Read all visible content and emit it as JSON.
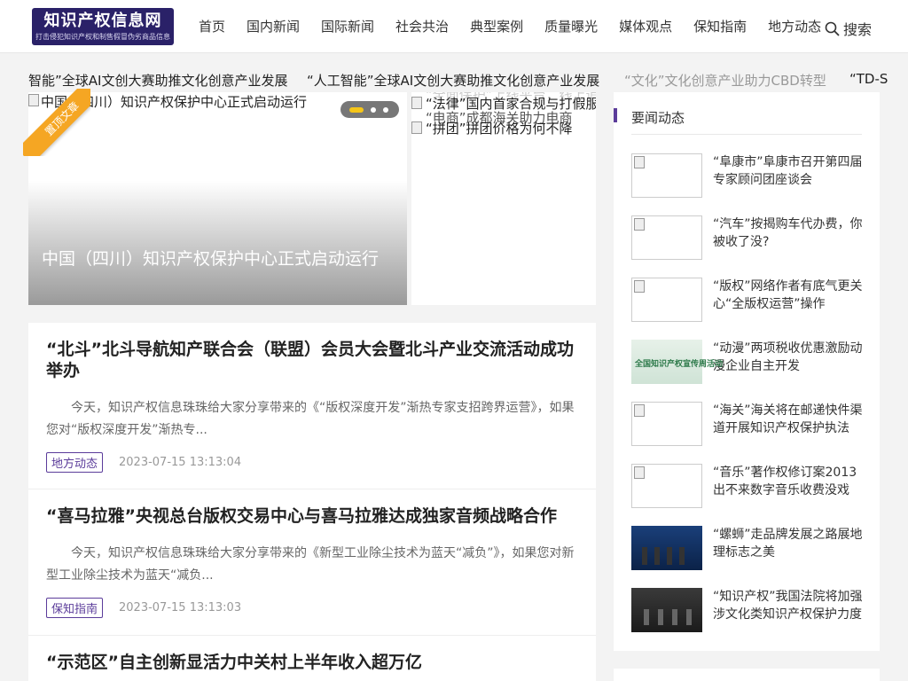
{
  "header": {
    "logo_title": "知识产权信息网",
    "logo_subtitle": "打击侵犯知识产权和制售假冒伪劣商品信息",
    "nav": [
      "首页",
      "国内新闻",
      "国际新闻",
      "社会共治",
      "典型案例",
      "质量曝光",
      "媒体观点",
      "保知指南",
      "地方动态"
    ],
    "search_label": "搜索",
    "search_icon": "magnifier-icon"
  },
  "ticker": {
    "items": [
      "智能”全球AI文创大赛助推文化创意产业发展",
      "“人工智能”全球AI文创大赛助推文化创意产业发展",
      "“文化”文化创意产业助力CBD转型",
      "“TD-S"
    ]
  },
  "slider": {
    "main_alt": "中国（四川）知识产权保护中心正式启动运行",
    "main_caption": "中国（四川）知识产权保护中心正式启动运行",
    "ribbon": "置顶文章",
    "side_items": [
      "“法律”国内首家合规与打假服务平台",
      "“电商”成都海关助力电商",
      "“拼团”拼团价格为何不降"
    ],
    "side_faded": "“全面保护”上线平台，线上追踪假冒"
  },
  "articles": [
    {
      "title": "“北斗”北斗导航知产联合会（联盟）会员大会暨北斗产业交流活动成功举办",
      "summary": "今天，知识产权信息珠珠给大家分享带来的《“版权深度开发”渐热专家支招跨界运营》，如果您对“版权深度开发”渐热专...",
      "tag": "地方动态",
      "date": "2023-07-15 13:13:04"
    },
    {
      "title": "“喜马拉雅”央视总台版权交易中心与喜马拉雅达成独家音频战略合作",
      "summary": "今天，知识产权信息珠珠给大家分享带来的《新型工业除尘技术为蓝天“减负”》，如果您对新型工业除尘技术为蓝天“减负...",
      "tag": "保知指南",
      "date": "2023-07-15 13:13:03"
    },
    {
      "title": "“示范区”自主创新显活力中关村上半年收入超万亿"
    }
  ],
  "sidebar": {
    "title": "要闻动态",
    "items": [
      {
        "text": "“阜康市”阜康市召开第四届专家顾问团座谈会",
        "thumb": "broken"
      },
      {
        "text": "“汽车”按揭购车代办费，你被收了没?",
        "thumb": "broken"
      },
      {
        "text": "“版权”网络作者有底气更关心“全版权运营”操作",
        "thumb": "broken"
      },
      {
        "text": "“动漫”两项税收优惠激励动漫企业自主开发",
        "thumb": "image",
        "thumb_text": "全国知识产权宣传周活动"
      },
      {
        "text": "“海关”海关将在邮递快件渠道开展知识产权保护执法",
        "thumb": "broken"
      },
      {
        "text": "“音乐”著作权修订案2013出不来数字音乐收费没戏",
        "thumb": "broken"
      },
      {
        "text": "“螺蛳”走品牌发展之路展地理标志之美",
        "thumb": "photo-blue"
      },
      {
        "text": "“知识产权”我国法院将加强涉文化类知识产权保护力度",
        "thumb": "photo-dark"
      }
    ]
  },
  "colors": {
    "accent": "#5b3c9a",
    "logo_bg": "#2a2168",
    "ribbon": "#f5a623"
  }
}
